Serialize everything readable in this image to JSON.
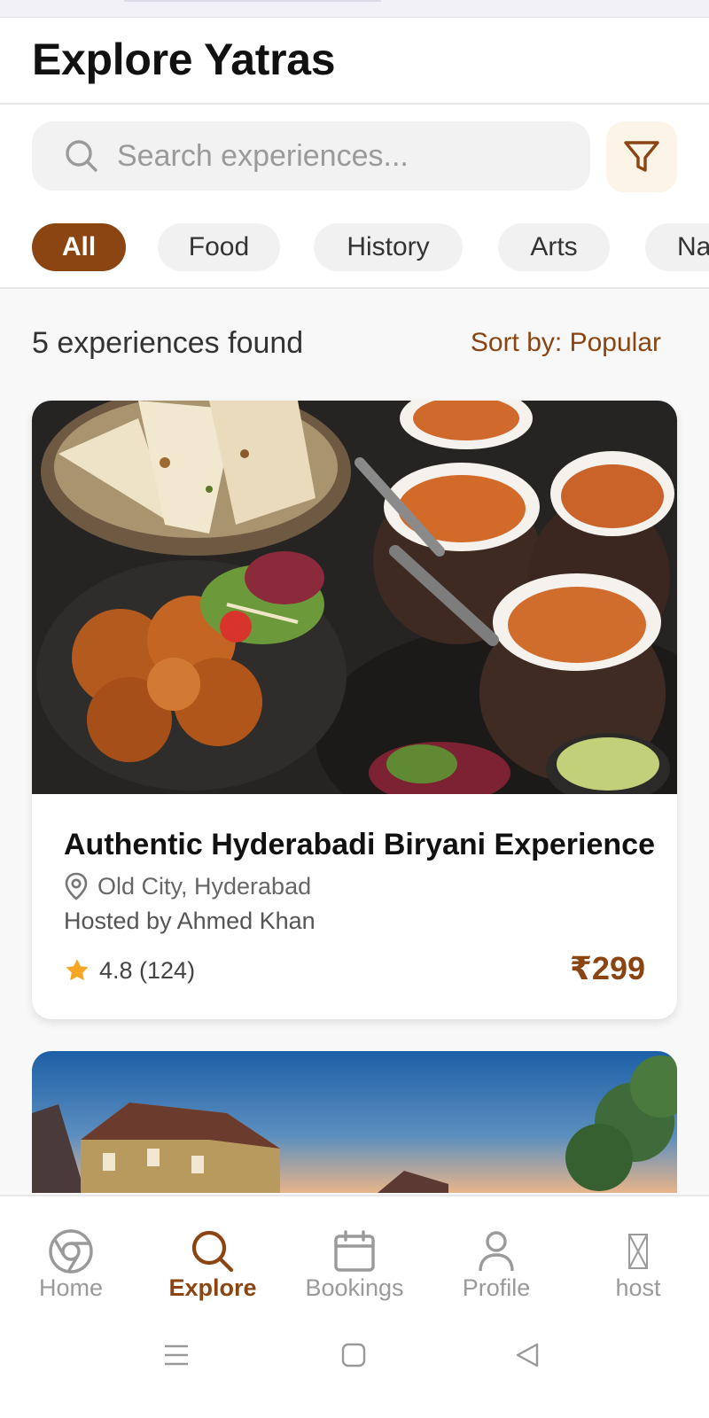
{
  "header": {
    "title": "Explore Yatras"
  },
  "search": {
    "placeholder": "Search experiences...",
    "value": ""
  },
  "categories": [
    "All",
    "Food",
    "History",
    "Arts",
    "Na"
  ],
  "active_category": "All",
  "results": {
    "count_text": "5 experiences found",
    "sort_text": "Sort by: Popular"
  },
  "experiences": [
    {
      "title": "Authentic Hyderabadi Biryani Experience",
      "location": "Old City, Hyderabad",
      "host": "Hosted by Ahmed Khan",
      "rating": "4.8 (124)",
      "price": "₹299"
    }
  ],
  "nav": {
    "items": [
      {
        "label": "Home",
        "icon": "chrome-icon"
      },
      {
        "label": "Explore",
        "icon": "search-icon",
        "active": true
      },
      {
        "label": "Bookings",
        "icon": "calendar-icon"
      },
      {
        "label": "Profile",
        "icon": "person-icon"
      },
      {
        "label": "host",
        "icon": "missing-image-icon"
      }
    ]
  },
  "colors": {
    "accent": "#8b4513",
    "star": "#f5a623",
    "filter_bg": "#fdf4e8"
  }
}
